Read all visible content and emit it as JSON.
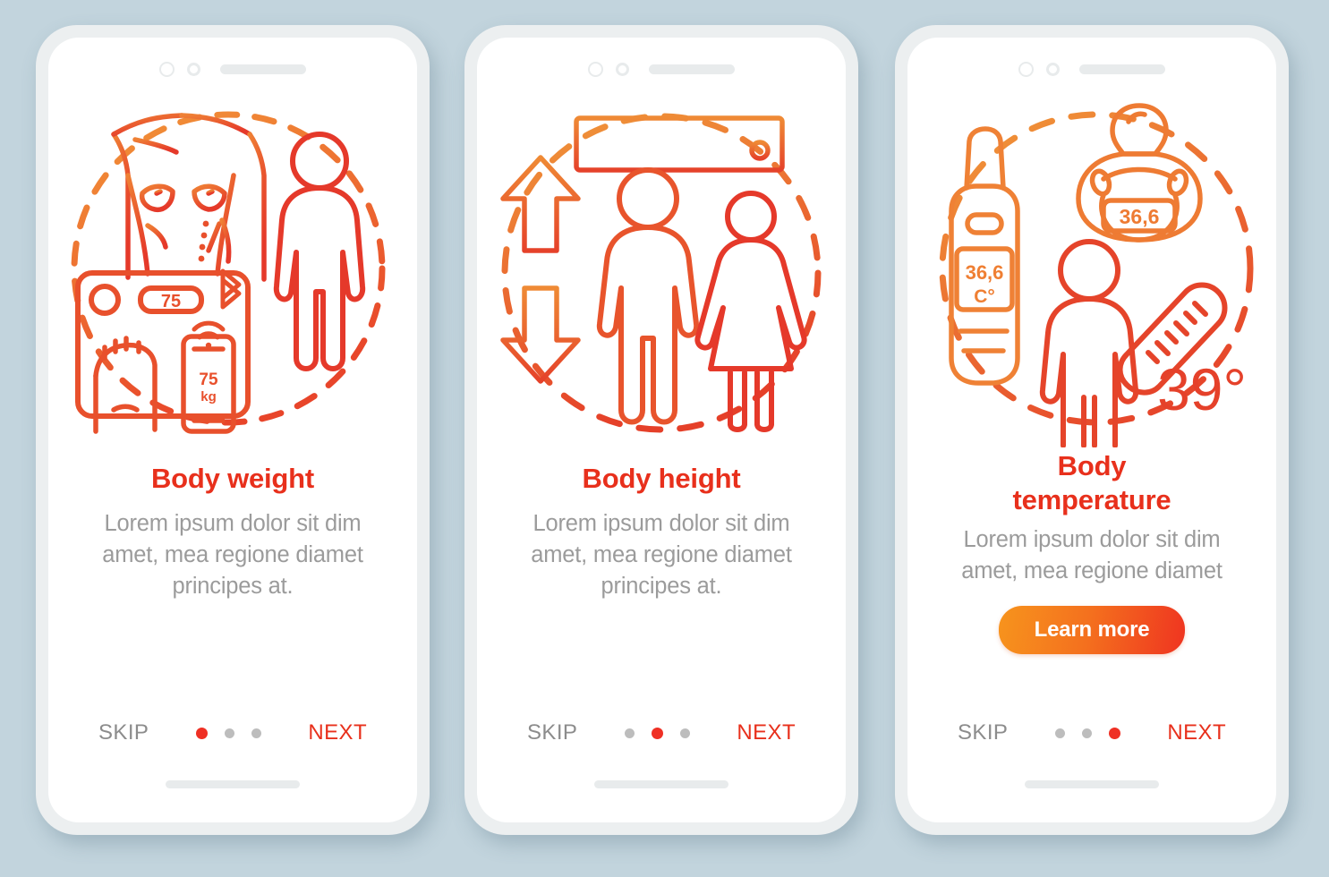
{
  "background_color": "#c2d4dd",
  "theme": {
    "title_color": "#e8301c",
    "desc_color": "#9b9b9b",
    "accent_orange": "#f7941d",
    "accent_red": "#ef3420",
    "dot_active": "#ef3024",
    "dot_inactive": "#bdbdbd",
    "skip_color": "#8c8c8c",
    "next_color": "#e8301c"
  },
  "screens": [
    {
      "id": "body-weight",
      "title": "Body weight",
      "description": "Lorem ipsum dolor sit dim amet, mea regione diamet principes at.",
      "skip_label": "SKIP",
      "next_label": "NEXT",
      "active_dot": 0,
      "dot_count": 3,
      "cta": null,
      "illustration": {
        "name": "body-weight-illustration",
        "elements": [
          "torso-outline",
          "smart-scale",
          "scale-display",
          "bluetooth-icon",
          "wifi-signal-icon",
          "smartphone",
          "foot",
          "person-figure",
          "dashed-circle"
        ],
        "scale_display_value": "75",
        "phone_value": "75",
        "phone_unit": "kg"
      }
    },
    {
      "id": "body-height",
      "title": "Body height",
      "description": "Lorem ipsum dolor sit dim amet, mea regione diamet principes at.",
      "skip_label": "SKIP",
      "next_label": "NEXT",
      "active_dot": 1,
      "dot_count": 3,
      "cta": null,
      "illustration": {
        "name": "body-height-illustration",
        "elements": [
          "ruler",
          "arrow-up",
          "arrow-down",
          "man-figure",
          "woman-figure",
          "dashed-circle"
        ]
      }
    },
    {
      "id": "body-temperature",
      "title": "Body temperature",
      "description": "Lorem ipsum dolor sit dim amet, mea regione diamet",
      "skip_label": "SKIP",
      "next_label": "NEXT",
      "active_dot": 2,
      "dot_count": 3,
      "cta": "Learn more",
      "illustration": {
        "name": "body-temperature-illustration",
        "elements": [
          "digital-thermometer",
          "pacifier-thermometer",
          "person-figure",
          "clinical-thermometer",
          "dashed-circle"
        ],
        "digital_value": "36,6",
        "digital_unit": "C°",
        "pacifier_value": "36,6",
        "fever_value": "39°"
      }
    }
  ]
}
